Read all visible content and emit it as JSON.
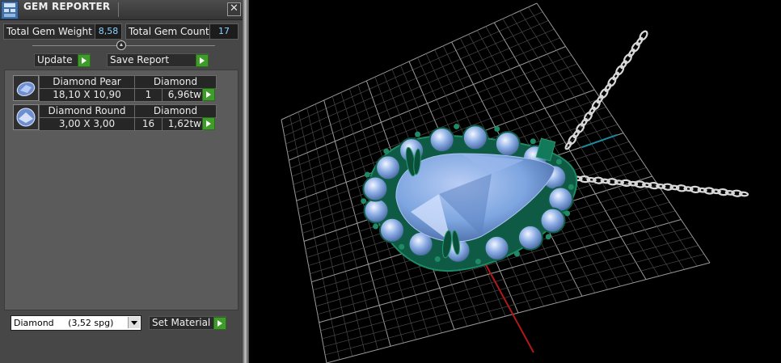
{
  "window": {
    "title": "GEM REPORTER",
    "close_label": "✕"
  },
  "summary": {
    "weight_label": "Total Gem Weight",
    "weight_value": "8,58",
    "count_label": "Total Gem Count",
    "count_value": "17"
  },
  "actions": {
    "update_label": "Update",
    "save_report_label": "Save Report"
  },
  "gems": [
    {
      "name": "Diamond Pear",
      "material": "Diamond",
      "size": "18,10 X 10,90",
      "count": "1",
      "weight": "6,96tw",
      "icon": "pear-gem-icon"
    },
    {
      "name": "Diamond Round",
      "material": "Diamond",
      "size": "3,00 X 3,00",
      "count": "16",
      "weight": "1,62tw",
      "icon": "round-gem-icon"
    }
  ],
  "material": {
    "selected": "Diamond     (3,52 spg)",
    "set_label": "Set Material"
  },
  "colors": {
    "panel": "#474747",
    "value_text": "#8fd0ff",
    "play_button": "#3f9c2a",
    "gem_blue": "#7ea6e0",
    "prong_green": "#1e8a66"
  }
}
